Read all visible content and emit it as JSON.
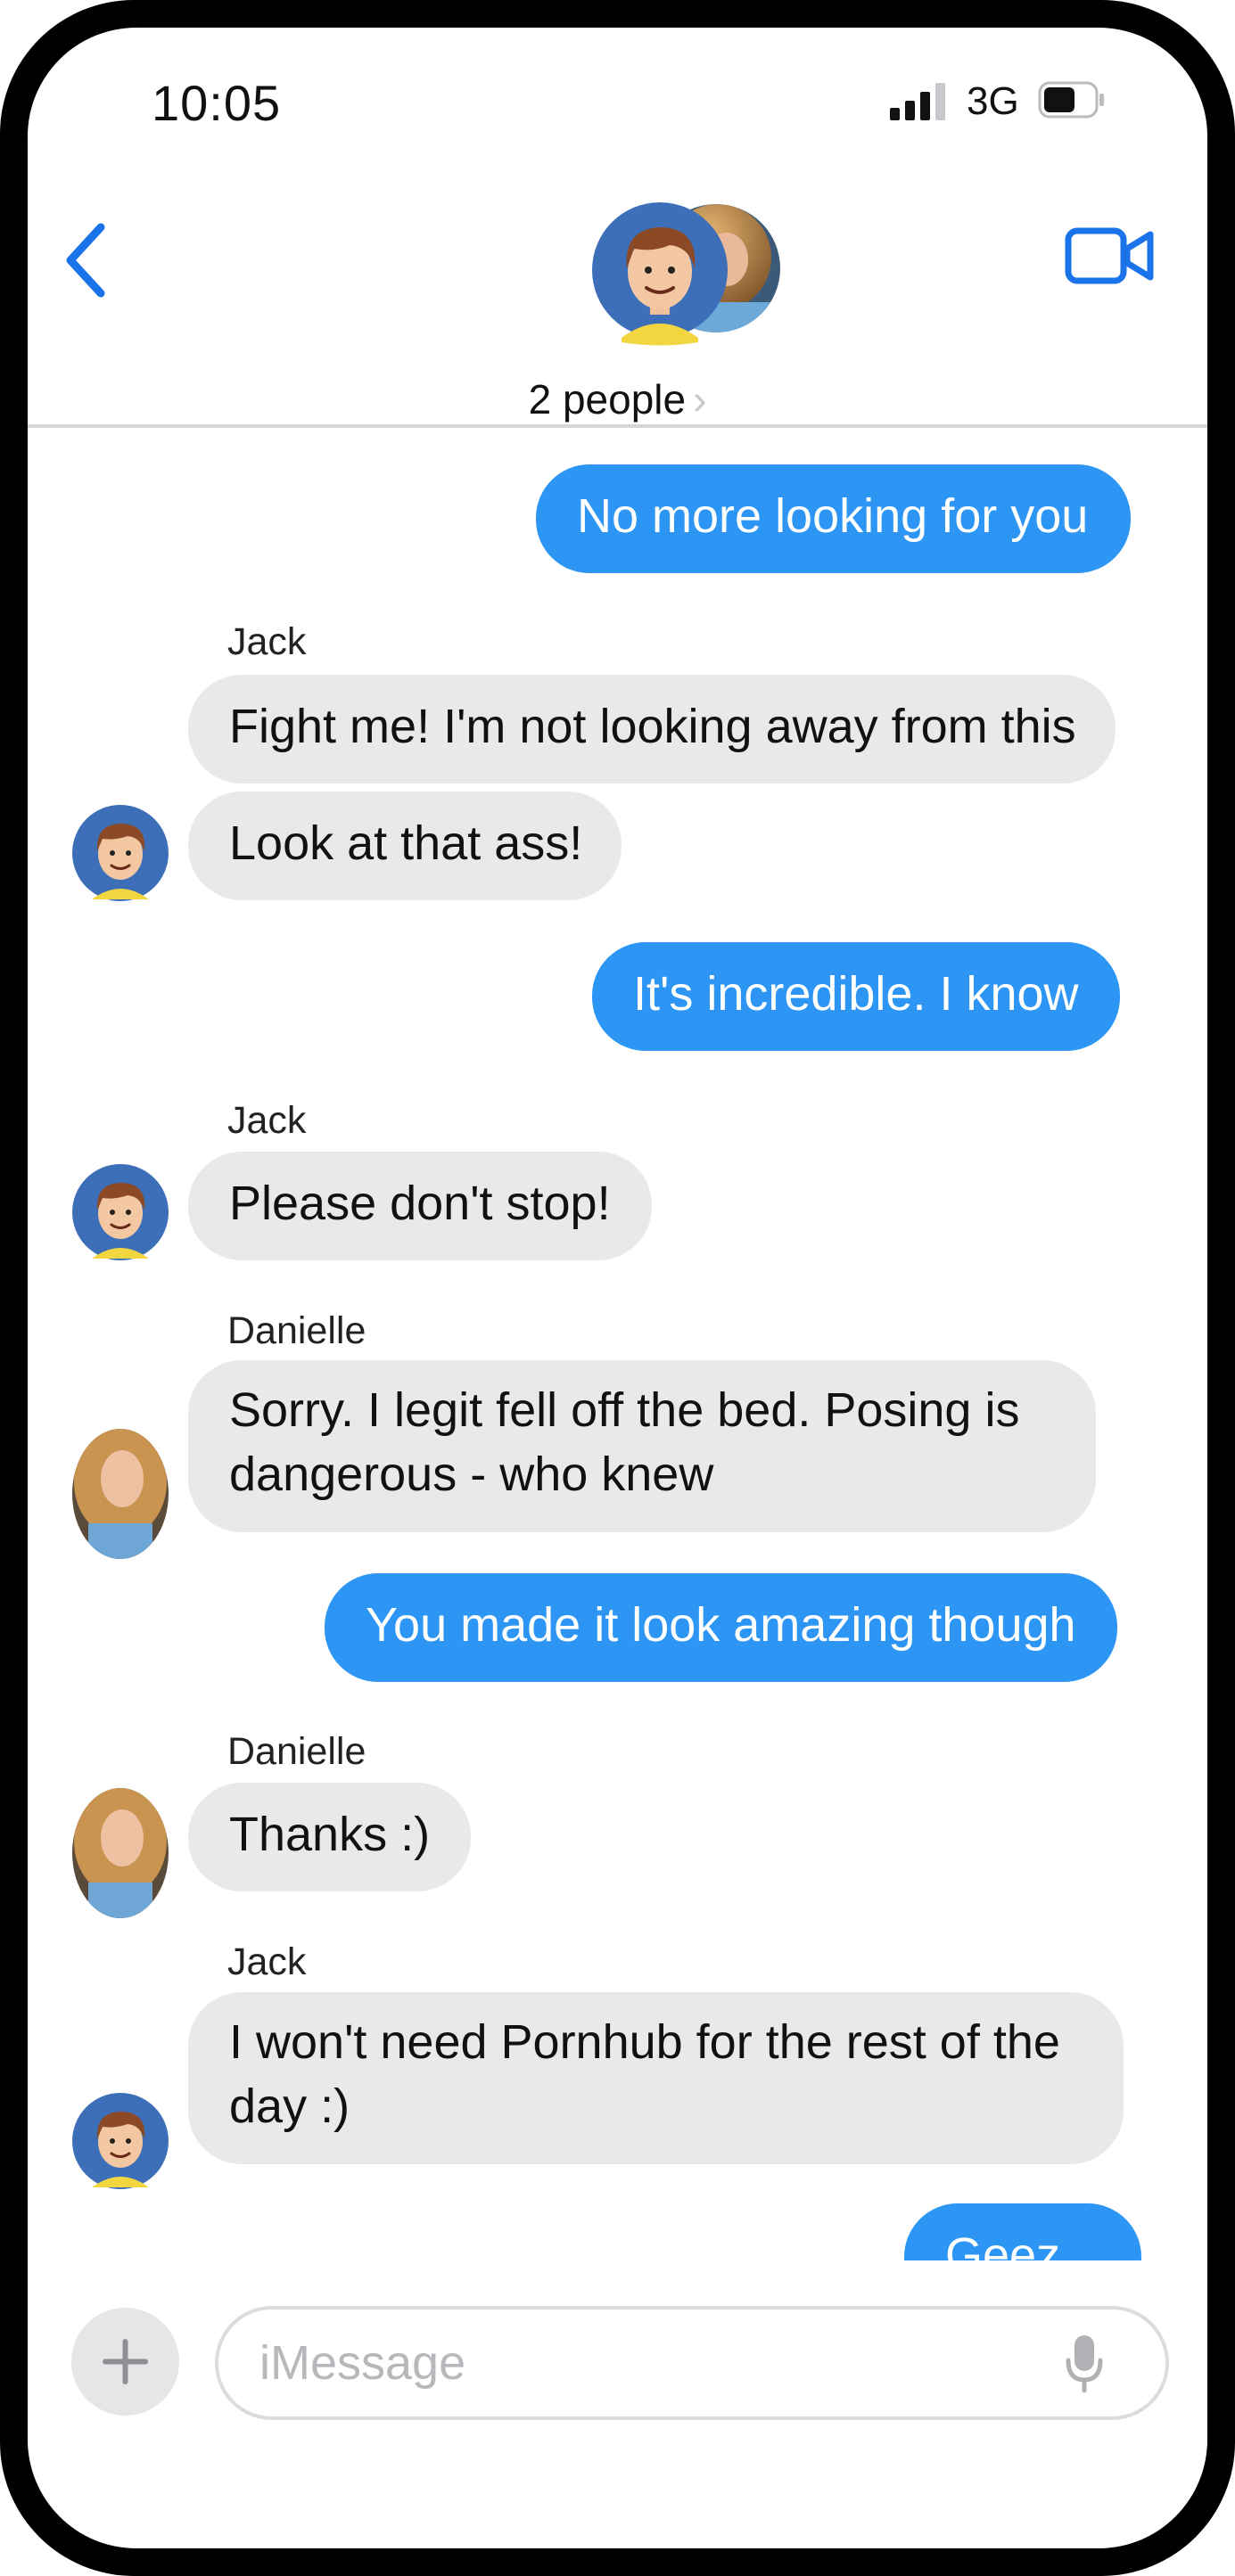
{
  "status_bar": {
    "time": "10:05",
    "network": "3G"
  },
  "header": {
    "title": "2 people",
    "chevron": "›",
    "icons": [
      "back-chevron-icon",
      "video-camera-icon"
    ]
  },
  "messages": [
    {
      "direction": "out",
      "text": "No more looking for you"
    },
    {
      "direction": "in",
      "sender": "Jack",
      "text": "Fight me!  I'm not looking away from this"
    },
    {
      "direction": "in",
      "text": "Look at that ass!"
    },
    {
      "direction": "out",
      "text": "It's incredible.  I know"
    },
    {
      "direction": "in",
      "sender": "Jack",
      "text": "Please don't stop!"
    },
    {
      "direction": "in",
      "sender": "Danielle",
      "lines": [
        "Sorry.  I legit fell off the bed.  Posing is",
        "dangerous - who knew"
      ]
    },
    {
      "direction": "out",
      "text": "You made it look amazing though"
    },
    {
      "direction": "in",
      "sender": "Danielle",
      "text": "Thanks :)"
    },
    {
      "direction": "in",
      "sender": "Jack",
      "lines": [
        "I won't need Pornhub for the rest of the",
        "day :)"
      ]
    },
    {
      "direction": "out",
      "text": "Geez..."
    }
  ],
  "composer": {
    "plus": "+",
    "placeholder": "iMessage",
    "value": ""
  },
  "colors": {
    "outgoing": "#2d96f5",
    "incoming": "#e9e9eb",
    "accent": "#1a73e8"
  }
}
